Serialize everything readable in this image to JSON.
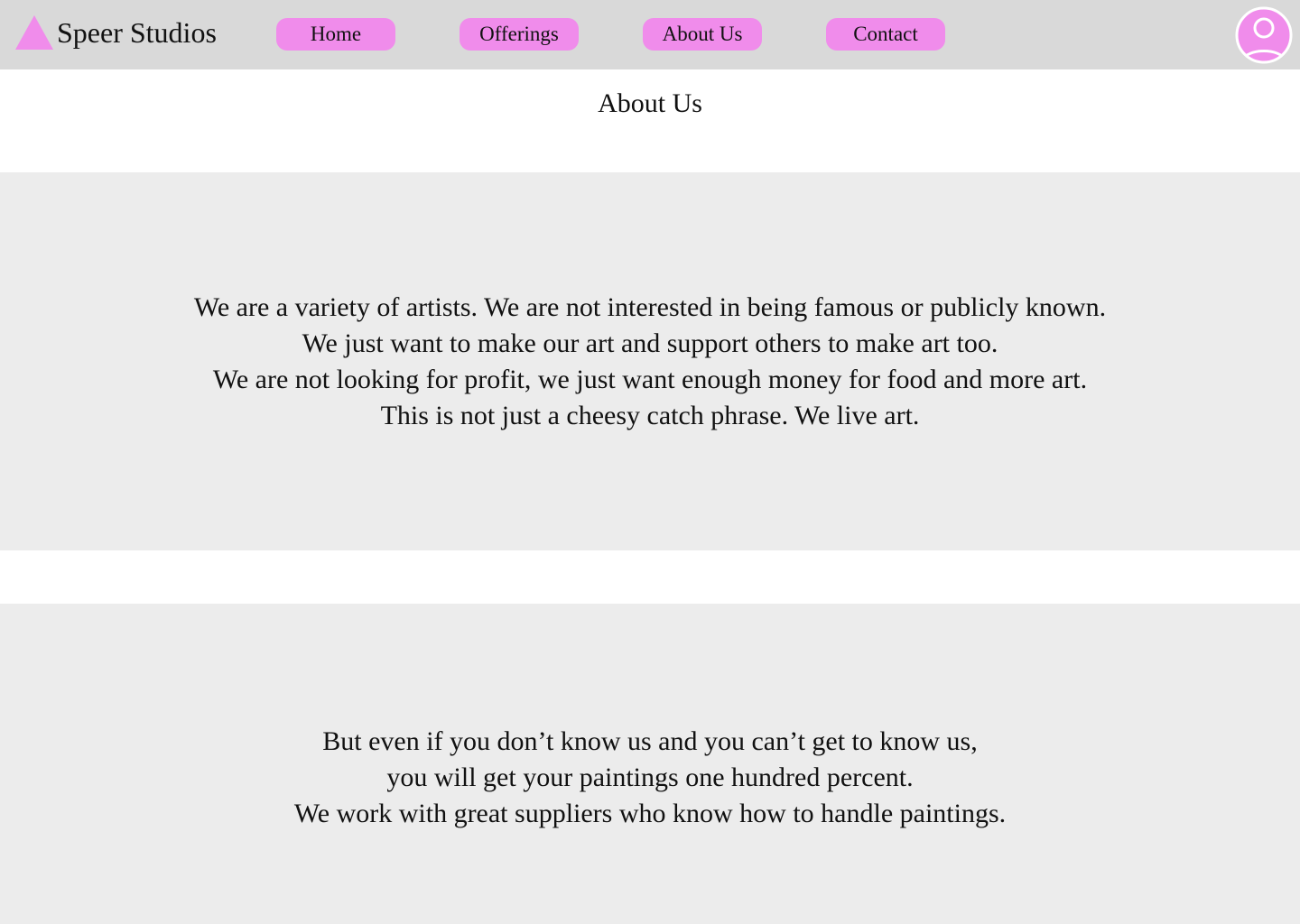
{
  "header": {
    "brand": "Speer Studios",
    "nav": [
      {
        "label": "Home"
      },
      {
        "label": "Offerings"
      },
      {
        "label": "About Us"
      },
      {
        "label": "Contact"
      }
    ],
    "accent_color": "#f08ceb",
    "background_color": "#d9d9d9",
    "logo_icon": "triangle-logo-icon",
    "profile_icon": "user-profile-icon"
  },
  "main": {
    "title": "About Us",
    "section1": {
      "lines": [
        "We are a variety of artists. We are not interested in being famous or publicly known.",
        "We just want to make our art and support others to make art too.",
        "We are not looking for profit, we just want enough money for food and more art.",
        "This is not just a cheesy catch phrase. We live art."
      ]
    },
    "section2": {
      "lines": [
        "But even if you don’t know us and you can’t get to know us,",
        "you will get your paintings one hundred percent.",
        "We work with great suppliers who know how to handle paintings."
      ]
    },
    "panel_color": "#ececec"
  }
}
